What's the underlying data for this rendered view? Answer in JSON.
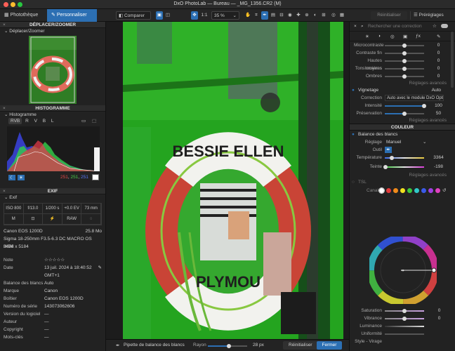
{
  "window": {
    "title": "DxO PhotoLab — Bureau — _MG_1356.CR2 (M)"
  },
  "tabs": {
    "phototeque": "Photothèque",
    "personnaliser": "Personnaliser"
  },
  "toolbar": {
    "compare": "Comparer",
    "ratio": "1:1",
    "zoom": "35 %",
    "reset": "Réinitialiser",
    "presets": "Préréglages"
  },
  "left": {
    "move_title": "DÉPLACER/ZOOMER",
    "move_sub": "Déplacer/Zoomer",
    "histo_title": "HISTOGRAMME",
    "histo_sub": "Histogramme",
    "channels": [
      "RVB",
      "R",
      "V",
      "B",
      "L"
    ],
    "rgb_r": "251",
    "rgb_g": "251",
    "rgb_b": "251",
    "exif_title": "EXIF",
    "exif_sub": "Exif",
    "exif_cells": [
      "ISO 800",
      "f/13.0",
      "1/200 s",
      "+0.0 EV",
      "73 mm",
      "M",
      "",
      "",
      "RAW",
      ""
    ],
    "camera": "Canon EOS 1200D",
    "filesize": "25.8 Mo",
    "lens": "Sigma 18-250mm F3.5-6.3 DC MACRO OS HSM",
    "dims": "3456 x 5184",
    "rows": [
      {
        "k": "Note",
        "v": "☆☆☆☆☆"
      },
      {
        "k": "Date",
        "v": "13 juil. 2024 à 18:40:52"
      },
      {
        "k": "",
        "v": "GMT+1"
      },
      {
        "k": "Balance des blancs",
        "v": "Auto"
      },
      {
        "k": "Marque",
        "v": "Canon"
      },
      {
        "k": "Boîtier",
        "v": "Canon EOS 1200D"
      },
      {
        "k": "Numéro de série",
        "v": "143073062606"
      },
      {
        "k": "Version du logiciel",
        "v": "—"
      },
      {
        "k": "Auteur",
        "v": "—"
      },
      {
        "k": "Copyright",
        "v": "—"
      },
      {
        "k": "Mots-clés",
        "v": "—"
      }
    ]
  },
  "photo": {
    "text_top": "BESSIE ELLEN",
    "text_bottom": "PLYMOU"
  },
  "bottom": {
    "tool": "Pipette de balance des blancs",
    "radius_label": "Rayon",
    "radius_val": "28 px",
    "reset": "Réinitialiser",
    "close": "Fermer"
  },
  "right": {
    "search_placeholder": "Rechercher une correction",
    "top_sliders": [
      {
        "label": "Microcontraste",
        "val": "0",
        "pos": 0.5
      },
      {
        "label": "Contraste fin",
        "val": "0",
        "pos": 0.5
      },
      {
        "label": "Hautes lumières",
        "val": "0",
        "pos": 0.5
      },
      {
        "label": "Tons moyens",
        "val": "0",
        "pos": 0.5
      },
      {
        "label": "Ombres",
        "val": "0",
        "pos": 0.5
      }
    ],
    "reglages": "Réglages avancés",
    "vignetage": "Vignetage",
    "vignetage_mode": "Auto",
    "correction_label": "Correction",
    "correction_val": "Auto avec le module DxO Optics",
    "intensite_label": "Intensité",
    "intensite_val": "100",
    "intensite_pos": 1.0,
    "preservation_label": "Préservation",
    "preservation_val": "50",
    "preservation_pos": 0.5,
    "couleur": "COULEUR",
    "wb": "Balance des blancs",
    "reglage_label": "Réglage",
    "reglage_val": "Manuel",
    "outil_label": "Outil",
    "temp_label": "Température",
    "temp_val": "3364",
    "temp_pos": 0.17,
    "teinte_label": "Teinte",
    "teinte_val": "-198",
    "teinte_pos": 0.02,
    "tsl": "TSL",
    "canal_label": "Canal",
    "swatches": [
      "#ffffff",
      "#e23a3a",
      "#f08a1a",
      "#f0e020",
      "#3cc83c",
      "#30c8c8",
      "#3a5ae8",
      "#a040e0",
      "#e040c0"
    ],
    "saturation_label": "Saturation",
    "saturation_val": "0",
    "vibrance_label": "Vibrance",
    "vibrance_val": "0",
    "luminance_label": "Luminance",
    "uniformite_label": "Uniformité",
    "style_label": "Style - Virage"
  },
  "colors": {
    "accent": "#2c6fb3",
    "viewer_green": "#23a21e"
  }
}
